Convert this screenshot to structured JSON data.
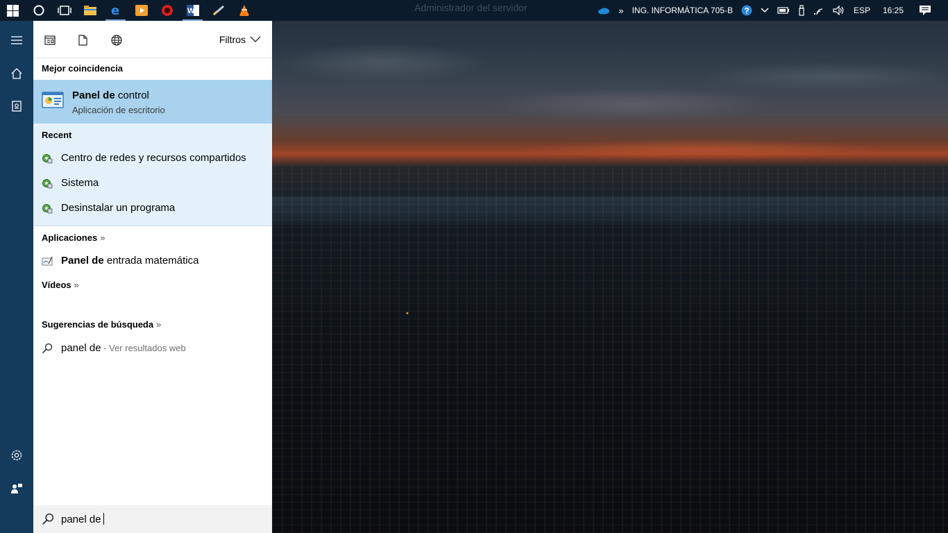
{
  "window_title": "Administrador del servidor",
  "tray": {
    "network_name": "ING. INFORMÁTICA 705-B",
    "language": "ESP",
    "time": "16:25"
  },
  "taskbar_apps": [
    {
      "icon": "windows-start-icon"
    },
    {
      "icon": "cortana-circle-icon"
    },
    {
      "icon": "task-view-icon"
    },
    {
      "icon": "file-explorer-icon",
      "color": "#f2c04b"
    },
    {
      "icon": "edge-browser-icon",
      "color": "#1e7fd8"
    },
    {
      "icon": "media-player-icon",
      "color": "#f08a1e"
    },
    {
      "icon": "red-circle-app-icon",
      "color": "#d8201f"
    },
    {
      "icon": "word-icon",
      "color": "#2a5699"
    },
    {
      "icon": "pen-tool-icon",
      "color": "#9aa"
    },
    {
      "icon": "vlc-icon",
      "color": "#f57f17"
    }
  ],
  "panel": {
    "filters_label": "Filtros",
    "best_match_header": "Mejor coincidencia",
    "best_match": {
      "title_bold": "Panel de",
      "title_rest": " control",
      "subtitle": "Aplicación de escritorio"
    },
    "recent_header": "Recent",
    "recent_items": [
      "Centro de redes y recursos compartidos",
      "Sistema",
      "Desinstalar un programa"
    ],
    "apps_header": "Aplicaciones",
    "apps_more": "»",
    "app_item": {
      "bold": "Panel de",
      "rest": " entrada matemática"
    },
    "videos_header": "Vídeos",
    "videos_more": "»",
    "suggestions_header": "Sugerencias de búsqueda",
    "suggestions_more": "»",
    "suggestion": {
      "query": "panel de",
      "hint": " - Ver resultados web"
    },
    "search_value": "panel de"
  },
  "colors": {
    "taskbar": "#0c1b2c",
    "rail": "#143a5c",
    "best_match_bg": "#a8d2ed",
    "recent_bg": "#e5f1fa"
  }
}
